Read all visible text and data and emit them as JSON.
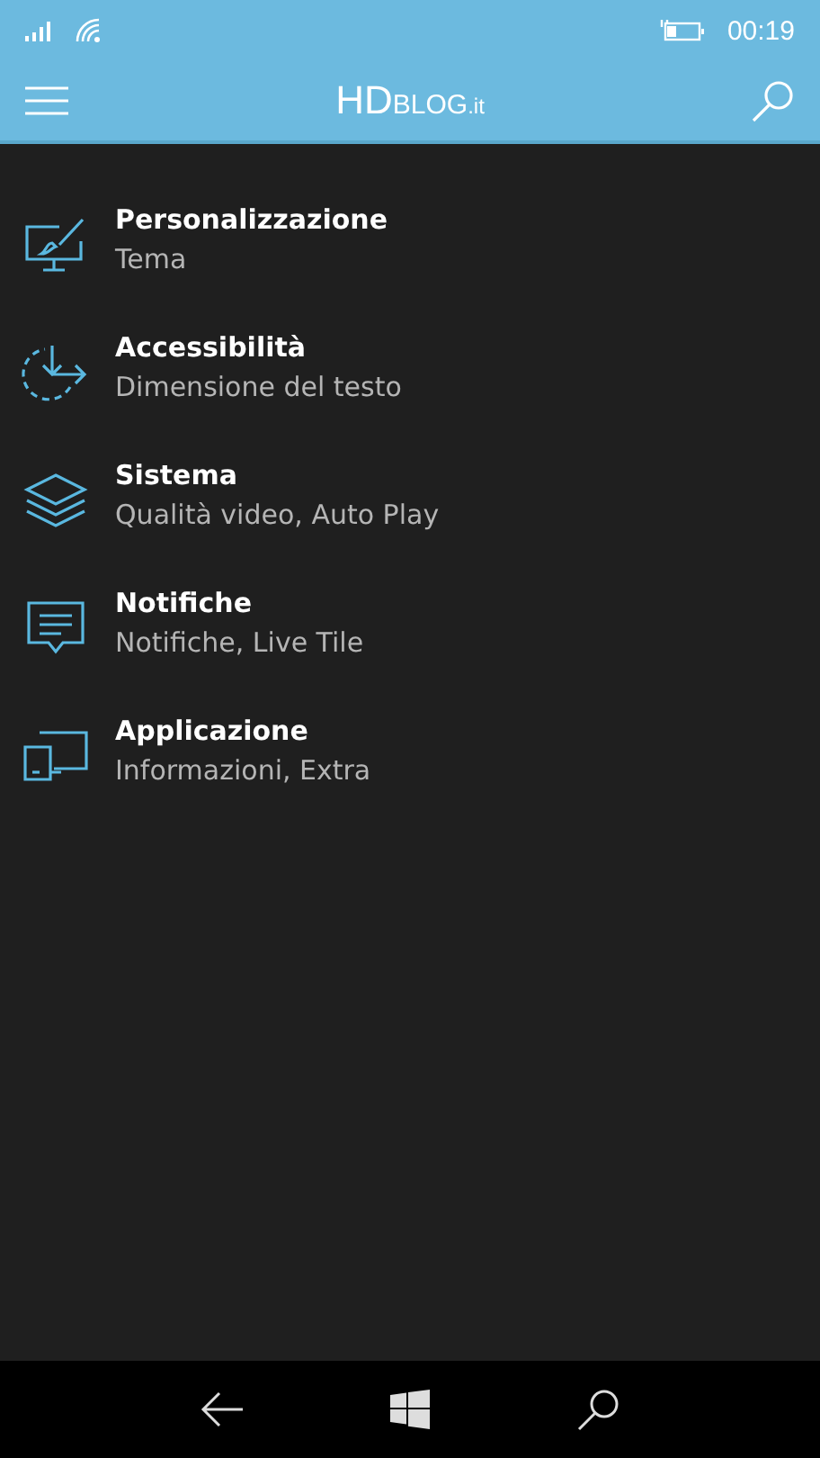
{
  "status_bar": {
    "time": "00:19"
  },
  "header": {
    "logo": {
      "main": "HD",
      "rest": "BLOG",
      "suffix": ".it"
    }
  },
  "settings": [
    {
      "kind": "personalize",
      "title": "Personalizzazione",
      "subtitle": "Tema"
    },
    {
      "kind": "accessibility",
      "title": "Accessibilità",
      "subtitle": "Dimensione del testo"
    },
    {
      "kind": "system",
      "title": "Sistema",
      "subtitle": "Qualità video, Auto Play"
    },
    {
      "kind": "notifications",
      "title": "Notifiche",
      "subtitle": "Notifiche, Live Tile"
    },
    {
      "kind": "application",
      "title": "Applicazione",
      "subtitle": "Informazioni, Extra"
    }
  ]
}
